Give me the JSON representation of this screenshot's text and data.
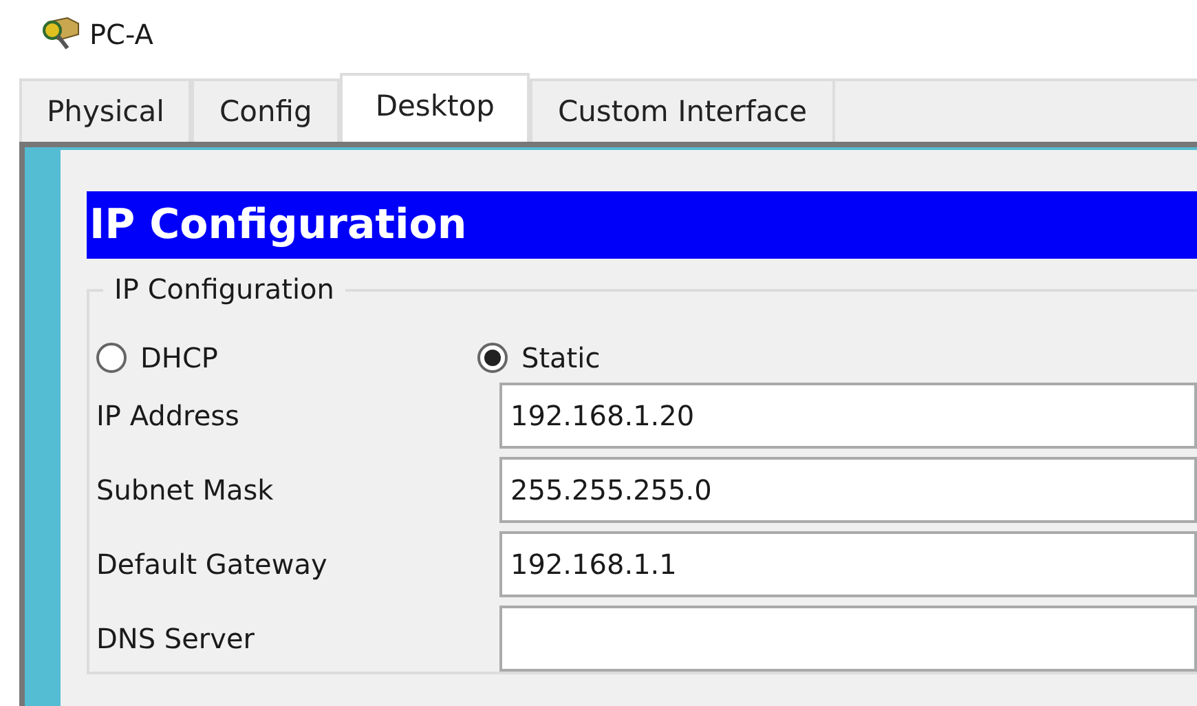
{
  "window": {
    "title": "PC-A"
  },
  "tabs": [
    {
      "label": "Physical",
      "selected": false
    },
    {
      "label": "Config",
      "selected": false
    },
    {
      "label": "Desktop",
      "selected": true
    },
    {
      "label": "Custom Interface",
      "selected": false
    }
  ],
  "panel": {
    "header": "IP Configuration",
    "group_title": "IP Configuration",
    "modes": [
      {
        "label": "DHCP",
        "selected": false
      },
      {
        "label": "Static",
        "selected": true
      }
    ],
    "fields": [
      {
        "label": "IP Address",
        "value": "192.168.1.20"
      },
      {
        "label": "Subnet Mask",
        "value": "255.255.255.0"
      },
      {
        "label": "Default Gateway",
        "value": "192.168.1.1"
      },
      {
        "label": "DNS Server"
      }
    ]
  }
}
